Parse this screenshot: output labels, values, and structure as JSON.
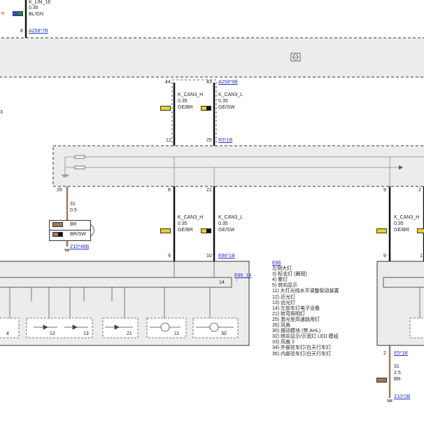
{
  "top_left": {
    "wire_name": "K_LIN_16",
    "gauge": "0.35",
    "color": "BL/GN",
    "pin": "8",
    "connector": "A258*7B",
    "left_fragment": "n"
  },
  "module_top": {
    "icon": "steering-wheel-icon"
  },
  "can_top": {
    "pin_h": "44",
    "pin_l": "43",
    "connector": "A258*8B",
    "h_name": "K_CAN3_H",
    "l_name": "K_CAN3_L",
    "gauge": "0.35",
    "h_color": "GE/BR",
    "l_color": "GE/SW",
    "pin_bottom_h": "12",
    "pin_bottom_l": "25",
    "connector_bottom": "R3*1B",
    "left_fragment": "3"
  },
  "distributor": {
    "pin_left": "26",
    "pin_h": "8",
    "pin_l": "21",
    "pin_right": "9",
    "pin_right2": "2"
  },
  "ground_wire": {
    "code": "31",
    "gauge": "0.5",
    "color_a": "BR",
    "color_b": "BR/SW",
    "connector": "Z10*48B"
  },
  "can_mid": {
    "h_name": "K_CAN3_H",
    "l_name": "K_CAN3_L",
    "gauge": "0.35",
    "h_color": "GE/BR",
    "l_color": "GE/SW",
    "pin_h": "9",
    "pin_l": "10",
    "connector": "E86*1B"
  },
  "can_right": {
    "h_name": "K_CAN3_H",
    "gauge": "0.35",
    "h_color": "GE/BR",
    "pin": "9",
    "pin2": "1"
  },
  "headlight": {
    "code": "E86",
    "sub_connector": "E86_14",
    "pin_14": "14",
    "pins": [
      "4",
      "12",
      "13",
      "21",
      "11",
      "30"
    ]
  },
  "legend": {
    "title": "E86",
    "subtitle": "左侧大灯",
    "items": [
      "3)   标志灯 (晨观)",
      "4)   雾灯",
      "5)   转向显示",
      "11) 大灯光线水平调整驱动装置",
      "12) 近光灯",
      "13) 远光灯",
      "14) 左前车灯电子设备",
      "21) 转弯照明灯",
      "25) 激光型高速路用灯",
      "26) 风扇",
      "30) 摆动模块 (带 AHL)",
      "32) 转向显示/示宽灯 LED 模组",
      "33) 风扇 2",
      "34) 外部驻车灯/白天行车灯",
      "35) 内部驻车灯/白天行车灯"
    ]
  },
  "right_ground": {
    "pin": "2",
    "connector_top": "E5*1B",
    "code": "31",
    "gauge": "2.5",
    "color": "BR",
    "connector": "Z10*2B"
  },
  "colors": {
    "yellow": "#e8d21e",
    "brown": "#a0795a",
    "blue": "#2a4bdc",
    "green": "#1f8a3a",
    "link": "#2233cc"
  }
}
